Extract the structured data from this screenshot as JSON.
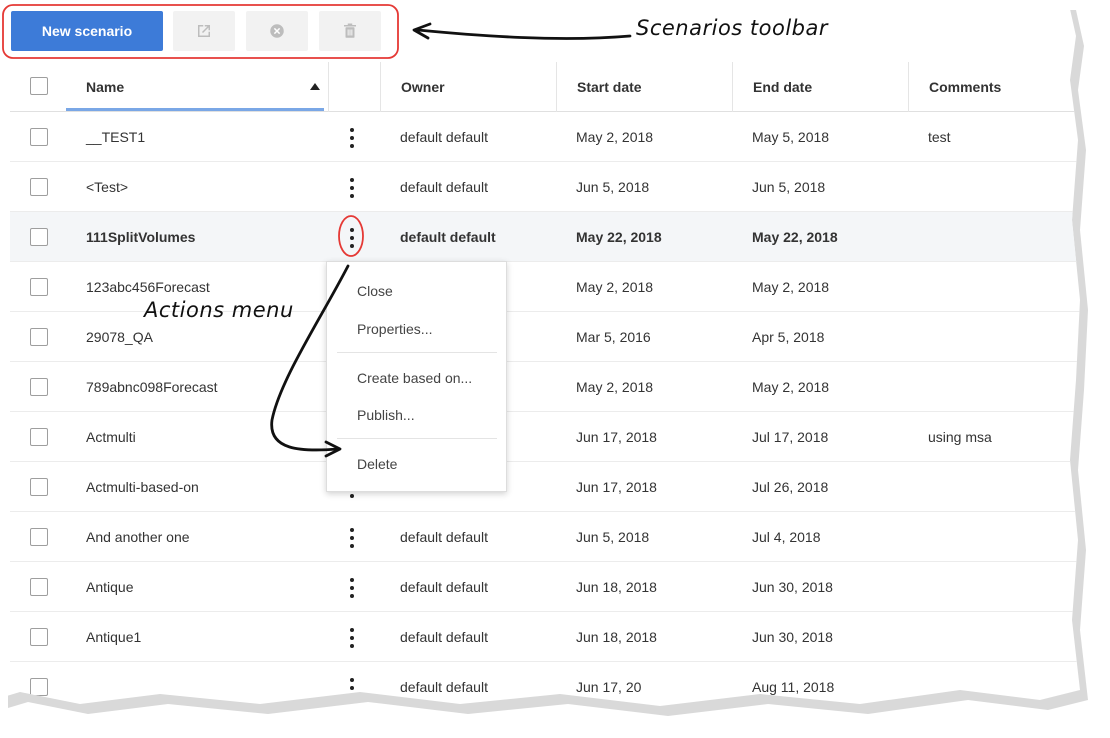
{
  "toolbar": {
    "new_scenario_label": "New scenario",
    "icons": [
      "open-external-icon",
      "close-circle-icon",
      "trash-icon"
    ]
  },
  "columns": {
    "name": "Name",
    "owner": "Owner",
    "start": "Start date",
    "end": "End date",
    "comments": "Comments",
    "sort": "ascending"
  },
  "rows": [
    {
      "name": "__TEST1",
      "owner": "default default",
      "start": "May 2, 2018",
      "end": "May 5, 2018",
      "comments": "test"
    },
    {
      "name": "<Test>",
      "owner": "default default",
      "start": "Jun 5, 2018",
      "end": "Jun 5, 2018",
      "comments": ""
    },
    {
      "name": "111SplitVolumes",
      "owner": "default default",
      "start": "May 22, 2018",
      "end": "May 22, 2018",
      "comments": "",
      "selected": true
    },
    {
      "name": "123abc456Forecast",
      "owner": "",
      "start": "May 2, 2018",
      "end": "May 2, 2018",
      "comments": ""
    },
    {
      "name": "29078_QA",
      "owner": "",
      "start": "Mar 5, 2016",
      "end": "Apr 5, 2018",
      "comments": ""
    },
    {
      "name": "789abnc098Forecast",
      "owner": "",
      "start": "May 2, 2018",
      "end": "May 2, 2018",
      "comments": ""
    },
    {
      "name": "Actmulti",
      "owner": "",
      "start": "Jun 17, 2018",
      "end": "Jul 17, 2018",
      "comments": "using msa"
    },
    {
      "name": "Actmulti-based-on",
      "owner": "",
      "start": "Jun 17, 2018",
      "end": "Jul 26, 2018",
      "comments": ""
    },
    {
      "name": "And another one",
      "owner": "default default",
      "start": "Jun 5, 2018",
      "end": "Jul 4, 2018",
      "comments": ""
    },
    {
      "name": "Antique",
      "owner": "default default",
      "start": "Jun 18, 2018",
      "end": "Jun 30, 2018",
      "comments": ""
    },
    {
      "name": "Antique1",
      "owner": "default default",
      "start": "Jun 18, 2018",
      "end": "Jun 30, 2018",
      "comments": ""
    },
    {
      "name": "",
      "owner": "default default",
      "start": "Jun 17, 20",
      "end": "Aug 11, 2018",
      "comments": ""
    }
  ],
  "actions_menu": {
    "close": "Close",
    "properties": "Properties...",
    "create_based_on": "Create based on...",
    "publish": "Publish...",
    "delete": "Delete"
  },
  "annotations": {
    "toolbar_callout": "Scenarios toolbar",
    "menu_callout": "Actions menu",
    "highlight_color": "#e53935"
  },
  "colors": {
    "primary": "#3d7bd8",
    "selected_row": "#f4f6f8"
  }
}
